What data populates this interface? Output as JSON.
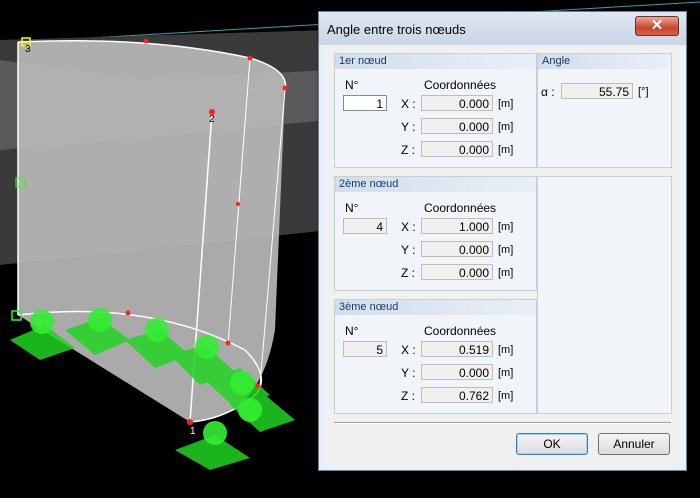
{
  "dialog": {
    "title": "Angle entre trois nœuds",
    "close_glyph": "✕"
  },
  "node1": {
    "header": "1er nœud",
    "no_label": "N°",
    "coord_label": "Coordonnées",
    "no_value": "1",
    "x_label": "X :",
    "x_value": "0.000",
    "x_unit": "[m]",
    "y_label": "Y :",
    "y_value": "0.000",
    "y_unit": "[m]",
    "z_label": "Z :",
    "z_value": "0.000",
    "z_unit": "[m]"
  },
  "node2": {
    "header": "2ème nœud",
    "no_label": "N°",
    "coord_label": "Coordonnées",
    "no_value": "4",
    "x_label": "X :",
    "x_value": "1.000",
    "x_unit": "[m]",
    "y_label": "Y :",
    "y_value": "0.000",
    "y_unit": "[m]",
    "z_label": "Z :",
    "z_value": "0.000",
    "z_unit": "[m]"
  },
  "node3": {
    "header": "3ème nœud",
    "no_label": "N°",
    "coord_label": "Coordonnées",
    "no_value": "5",
    "x_label": "X :",
    "x_value": "0.519",
    "x_unit": "[m]",
    "y_label": "Y :",
    "y_value": "0.000",
    "y_unit": "[m]",
    "z_label": "Z :",
    "z_value": "0.762",
    "z_unit": "[m]"
  },
  "angle": {
    "header": "Angle",
    "alpha_label": "α :",
    "alpha_value": "55.75",
    "alpha_unit": "[°]"
  },
  "buttons": {
    "ok": "OK",
    "cancel": "Annuler"
  },
  "viewport": {
    "node_labels": [
      "3",
      "2",
      "1"
    ],
    "support_color": "#22d422",
    "node_color": "#ff2020",
    "edge_color": "#ffffff"
  }
}
